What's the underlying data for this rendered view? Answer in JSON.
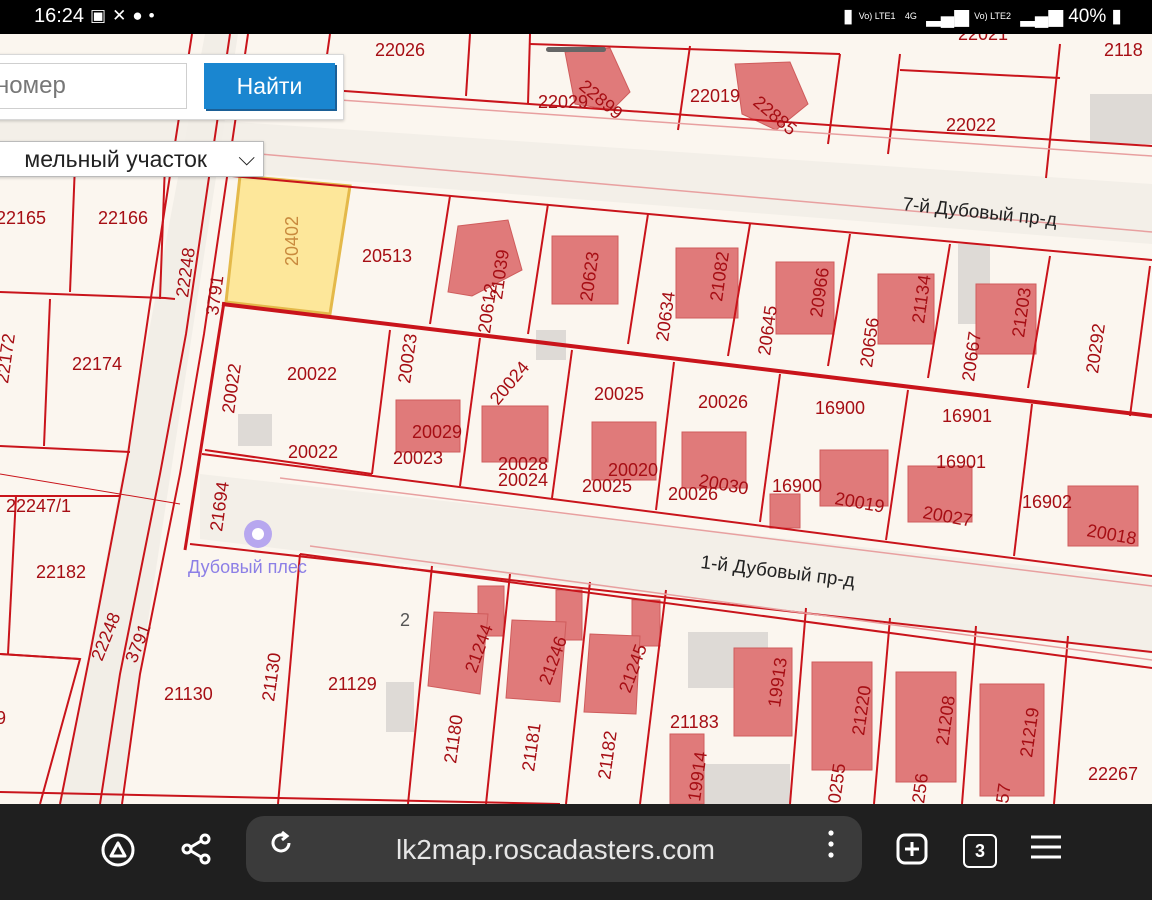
{
  "status_bar": {
    "time": "16:24",
    "battery": "40%",
    "sim1": "Vo) LTE1",
    "net_gen": "4G",
    "sim2": "Vo) LTE2"
  },
  "search": {
    "placeholder": "номер",
    "button_label": "Найти",
    "object_type": "мельный участок"
  },
  "map": {
    "streets": [
      "7-й Дубовый пр-д",
      "1-й Дубовый пр-д"
    ],
    "poi": "Дубовый плес",
    "selected_parcel": "20402",
    "parcels": [
      "22026",
      "22029",
      "22899",
      "22019",
      "22885",
      "22021",
      "22022",
      "2118",
      "22165",
      "22166",
      "22248",
      "3791",
      "20402",
      "20513",
      "20612",
      "21039",
      "20623",
      "20634",
      "21082",
      "20645",
      "20966",
      "20656",
      "21134",
      "20667",
      "21203",
      "20292",
      "22172",
      "22174",
      "20022",
      "20022",
      "20022",
      "20023",
      "20023",
      "20029",
      "20024",
      "20024",
      "20028",
      "20025",
      "20025",
      "20020",
      "20026",
      "20026",
      "20030",
      "16900",
      "16900",
      "20019",
      "16901",
      "16901",
      "20027",
      "16902",
      "20018",
      "21694",
      "22247/1",
      "22182",
      "22248",
      "3791",
      "2",
      "21244",
      "21246",
      "21245",
      "19913",
      "21220",
      "21208",
      "21219",
      "21130",
      "21130",
      "21129",
      "21180",
      "21181",
      "21182",
      "21183",
      "19914",
      "0255",
      "256",
      "57",
      "22267",
      "9"
    ]
  },
  "browser": {
    "url": "lk2map.roscadasters.com",
    "tab_count": "3"
  },
  "colors": {
    "parcel_line": "#c9141b",
    "building": "#e07a7a",
    "selected_fill": "#fde79a",
    "selected_stroke": "#e4b94a",
    "button": "#1a86d0"
  }
}
